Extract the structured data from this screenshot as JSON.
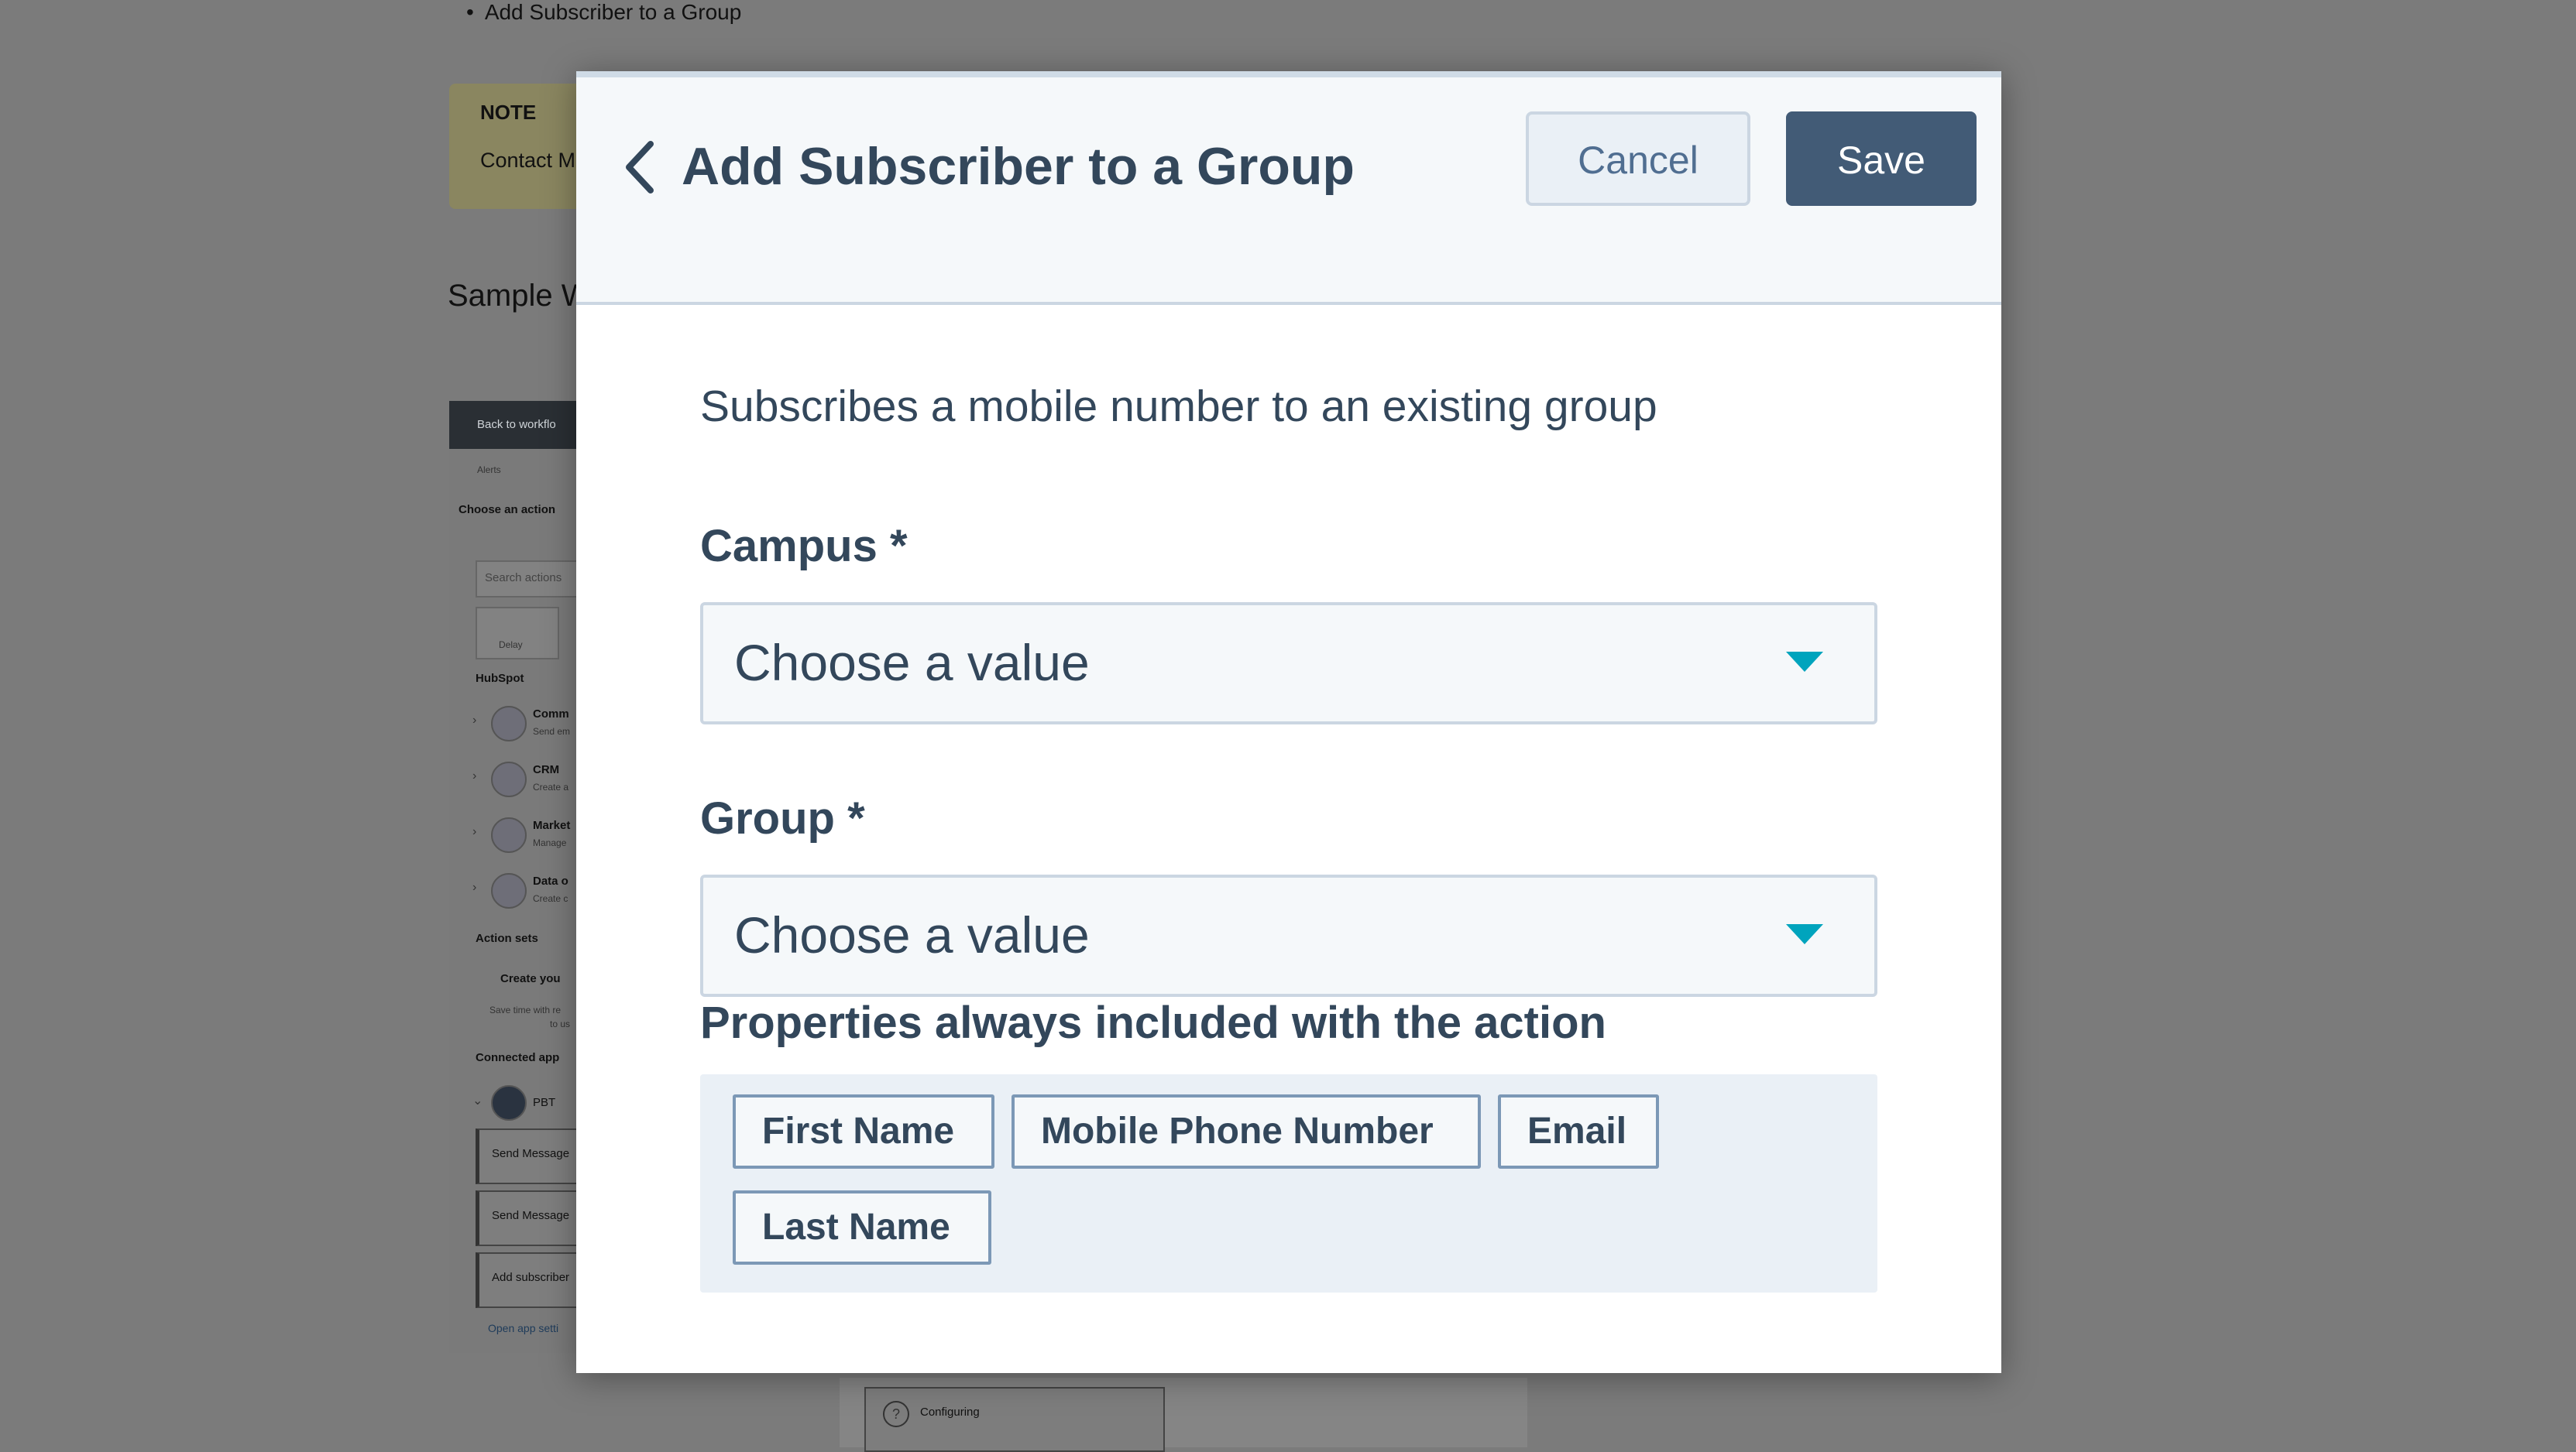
{
  "background": {
    "bullet_text": "Add Subscriber to a Group",
    "note_title": "NOTE",
    "note_text": "Contact M",
    "section_heading": "Sample W",
    "screenshot": {
      "back_link": "Back to workflo",
      "alerts_tab": "Alerts",
      "choose_action": "Choose an action",
      "search_placeholder": "Search actions",
      "delay_label": "Delay",
      "hubspot_label": "HubSpot",
      "categories": [
        {
          "title": "Comm",
          "sub": "Send em"
        },
        {
          "title": "CRM",
          "sub": "Create a"
        },
        {
          "title": "Market",
          "sub": "Manage"
        },
        {
          "title": "Data o",
          "sub": "Create c"
        }
      ],
      "action_sets_label": "Action sets",
      "create_your": "Create you",
      "save_time": "Save time with re",
      "save_time_2": "to us",
      "connected_apps": "Connected app",
      "app_name": "PBT",
      "app_actions": [
        "Send Message",
        "Send Message",
        "Add subscriber"
      ],
      "open_app_settings": "Open app setti",
      "configuring": "Configuring"
    }
  },
  "modal": {
    "title": "Add Subscriber to a Group",
    "cancel_label": "Cancel",
    "save_label": "Save",
    "description": "Subscribes a mobile number to an existing group",
    "fields": [
      {
        "label": "Campus *",
        "value": "Choose a value"
      },
      {
        "label": "Group *",
        "value": "Choose a value"
      }
    ],
    "properties_heading": "Properties always included with the action",
    "properties": [
      "First Name",
      "Mobile Phone Number",
      "Email",
      "Last Name"
    ]
  },
  "colors": {
    "text_primary": "#33475b",
    "save_bg": "#425b76",
    "caret": "#00a4bd",
    "overlay": "#7b7b7b"
  },
  "icons": {
    "back": "chevron-left-icon",
    "dropdown": "caret-down-icon"
  }
}
